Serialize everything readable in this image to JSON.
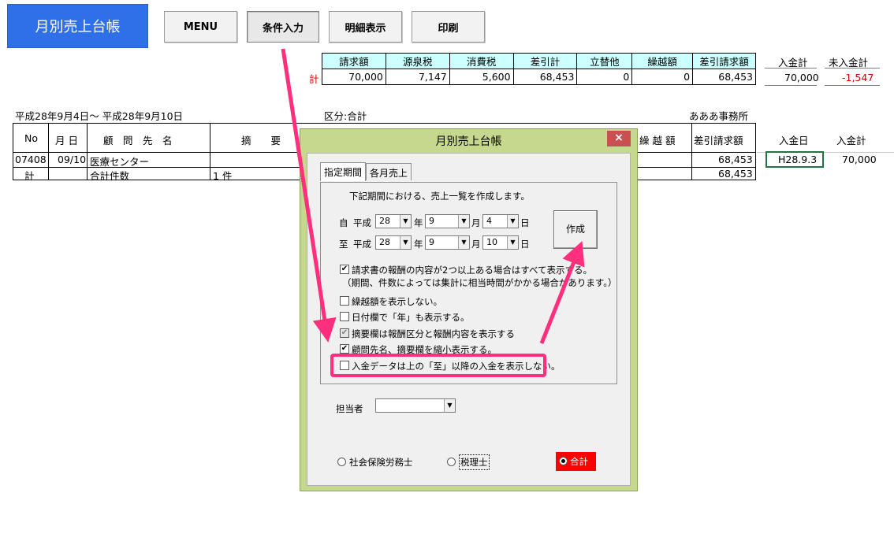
{
  "sheet": {
    "title_button": "月別売上台帳",
    "nav_buttons": [
      "MENU",
      "条件入力",
      "明細表示",
      "印刷"
    ]
  },
  "summary": {
    "headers": [
      "請求額",
      "源泉税",
      "消費税",
      "差引計",
      "立替他",
      "繰越額",
      "差引請求額"
    ],
    "row_label": "計",
    "values": [
      "70,000",
      "7,147",
      "5,600",
      "68,453",
      "0",
      "0",
      "68,453"
    ],
    "paid_total_label": "入金計",
    "unpaid_total_label": "未入金計",
    "paid_total": "70,000",
    "unpaid_total": "-1,547"
  },
  "list": {
    "period": "平成28年9月4日～ 平成28年9月10日",
    "division": "区分:合計",
    "office": "あああ事務所",
    "headers": {
      "no": "No",
      "date": "月 日",
      "client": "顧　問　先　名",
      "summary": "摘　　要",
      "carry": "繰 越 額",
      "net": "差引請求額",
      "paid_date": "入金日",
      "paid_total": "入金計"
    },
    "row": {
      "no": "07408",
      "date": "09/10",
      "client": "医療センター",
      "net": "68,453",
      "paid_date": "H28.9.3",
      "paid_total": "70,000"
    },
    "total_row": {
      "label": "計",
      "count_label": "合計件数",
      "count": "1 件",
      "net": "68,453"
    }
  },
  "dialog": {
    "title": "月別売上台帳",
    "close": "×",
    "tabs": [
      "指定期間",
      "各月売上"
    ],
    "instruction": "下記期間における、売上一覧を作成します。",
    "from": {
      "prefix": "自",
      "era": "平成",
      "year": "28",
      "month": "9",
      "day": "4"
    },
    "to": {
      "prefix": "至",
      "era": "平成",
      "year": "28",
      "month": "9",
      "day": "10"
    },
    "unit_year": "年",
    "unit_month": "月",
    "unit_day": "日",
    "create_button": "作成",
    "options": [
      {
        "label": "請求書の報酬の内容が2つ以上ある場合はすべて表示する。",
        "checked": true
      },
      {
        "label": "（期間、件数によっては集計に相当時間がかかる場合があります。）",
        "checked": null
      },
      {
        "label": "繰越額を表示しない。",
        "checked": false
      },
      {
        "label": "日付欄で「年」も表示する。",
        "checked": false
      },
      {
        "label": "摘要欄は報酬区分と報酬内容を表示する",
        "checked": true,
        "disabled": true
      },
      {
        "label": "顧問先名、摘要欄を縮小表示する。",
        "checked": true
      },
      {
        "label": "入金データは上の「至」以降の入金を表示しない。",
        "checked": false
      }
    ],
    "staff_label": "担当者",
    "staff_value": "",
    "radios": [
      {
        "label": "社会保険労務士",
        "selected": false
      },
      {
        "label": "税理士",
        "selected": false
      },
      {
        "label": "合計",
        "selected": true
      }
    ],
    "colors": {
      "frame": "#c6d88e",
      "close": "#c75050",
      "selected_radio_bg": "#ff0000",
      "annotation": "#ff2f7d"
    }
  }
}
